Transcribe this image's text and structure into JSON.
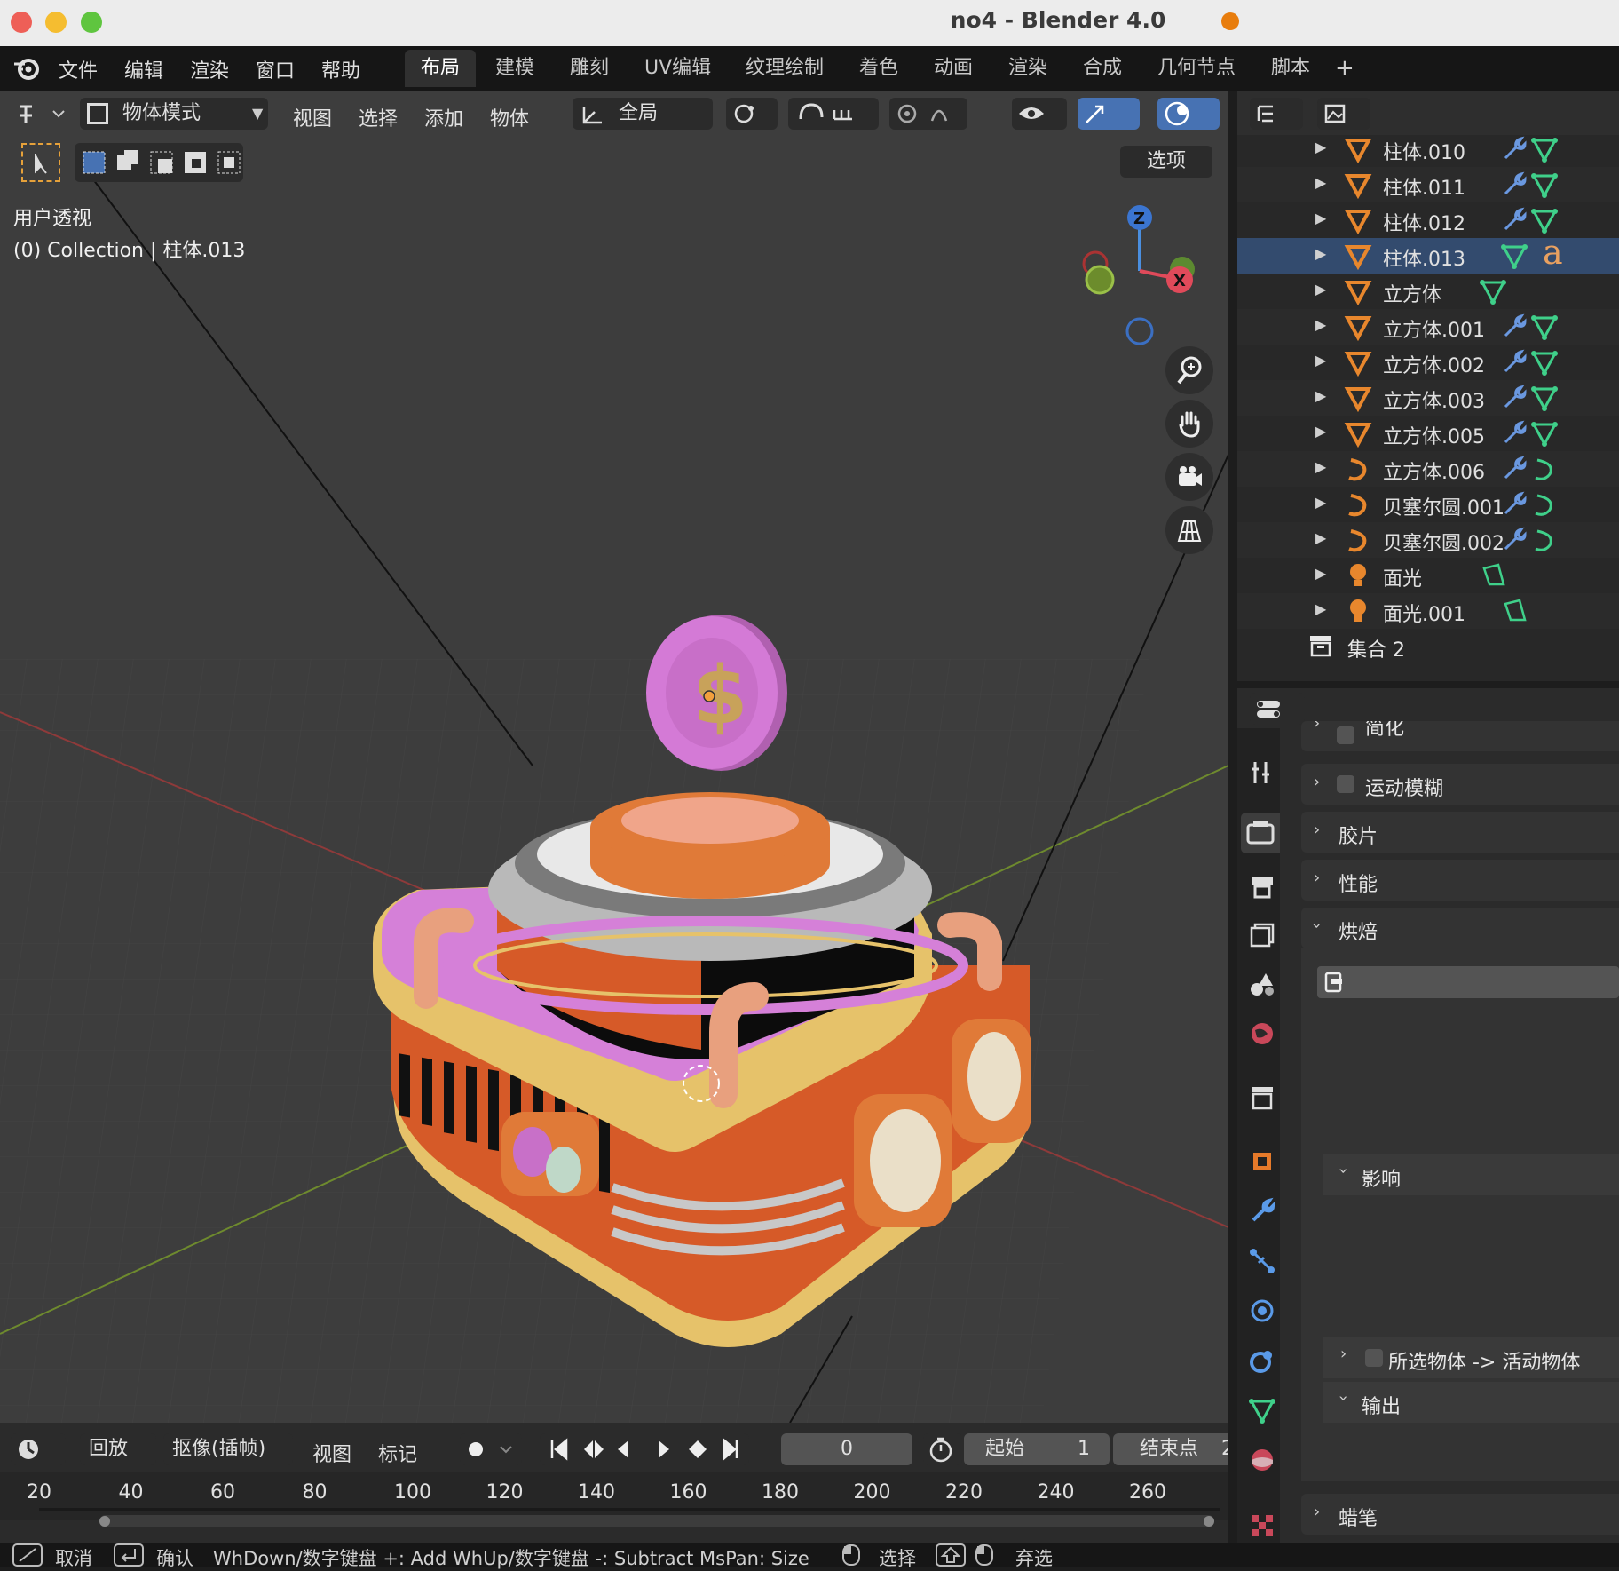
{
  "window": {
    "title": "no4 - Blender 4.0"
  },
  "menu": [
    "文件",
    "编辑",
    "渲染",
    "窗口",
    "帮助"
  ],
  "workspaces": [
    "布局",
    "建模",
    "雕刻",
    "UV编辑",
    "纹理绘制",
    "着色",
    "动画",
    "渲染",
    "合成",
    "几何节点",
    "脚本"
  ],
  "workspace_add": "+",
  "viewport_header": {
    "mode": "物体模式",
    "menus": [
      "视图",
      "选择",
      "添加",
      "物体"
    ],
    "orientation": "全局",
    "options": "选项"
  },
  "viewport_overlay": {
    "view_name": "用户透视",
    "collection_info": "(0) Collection | 柱体.013"
  },
  "gizmo": {
    "z": "Z",
    "x": "X"
  },
  "outliner": {
    "rows": [
      {
        "label": "柱体.010",
        "icon": "mesh-icon"
      },
      {
        "label": "柱体.011",
        "icon": "mesh-icon"
      },
      {
        "label": "柱体.012",
        "icon": "mesh-icon"
      },
      {
        "label": "柱体.013",
        "icon": "mesh-icon",
        "extra": "a"
      },
      {
        "label": "立方体",
        "icon": "mesh-icon"
      },
      {
        "label": "立方体.001",
        "icon": "mesh-icon"
      },
      {
        "label": "立方体.002",
        "icon": "mesh-icon"
      },
      {
        "label": "立方体.003",
        "icon": "mesh-icon"
      },
      {
        "label": "立方体.005",
        "icon": "mesh-icon"
      },
      {
        "label": "立方体.006",
        "icon": "curve-icon"
      },
      {
        "label": "贝塞尔圆.001",
        "icon": "curve-icon"
      },
      {
        "label": "贝塞尔圆.002",
        "icon": "curve-icon"
      },
      {
        "label": "面光",
        "icon": "light-icon"
      },
      {
        "label": "面光.001",
        "icon": "light-icon"
      }
    ],
    "collection2": "集合 2"
  },
  "properties": {
    "partial_top": "简化",
    "motion_blur": "运动模糊",
    "film": "胶片",
    "performance": "性能",
    "bake": "烘焙",
    "influence": "影响",
    "selected_to_active": "所选物体 -> 活动物体",
    "output": "输出",
    "grease_pencil": "蜡笔"
  },
  "timeline": {
    "playback": "回放",
    "keying": "抠像(插帧)",
    "view": "视图",
    "marker": "标记",
    "current_frame": "0",
    "start_label": "起始",
    "start_value": "1",
    "end_label": "结束点",
    "end_value_partial": "2",
    "ticks": [
      "20",
      "40",
      "60",
      "80",
      "100",
      "120",
      "140",
      "160",
      "180",
      "200",
      "220",
      "240",
      "260"
    ]
  },
  "status": {
    "cancel": "取消",
    "confirm": "确认",
    "hint": "WhDown/数字键盘 +: Add  WhUp/数字键盘 -: Subtract  MsPan: Size",
    "select": "选择",
    "deselect": "弃选"
  },
  "colors": {
    "accent_blue": "#4772b3",
    "coin_pink": "#d47ad6",
    "body_orange": "#d65a28",
    "trim_yellow": "#e6c26a",
    "lid_pink": "#d580d8"
  }
}
